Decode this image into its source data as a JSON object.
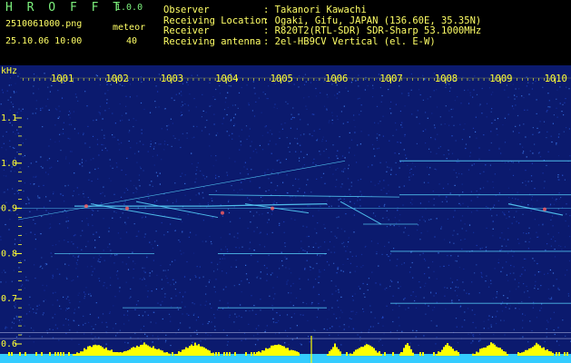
{
  "header": {
    "app_title": "H R O F F T",
    "app_version": "1.0.0",
    "file_name": "2510061000.png",
    "meteor_label": "meteor",
    "date_time": "25.10.06 10:00",
    "meteor_count": "40"
  },
  "info": [
    {
      "label": "Observer",
      "value": ": Takanori Kawachi"
    },
    {
      "label": "Receiving Location",
      "value": ": Ogaki, Gifu, JAPAN (136.60E, 35.35N)"
    },
    {
      "label": "Receiver",
      "value": ": R820T2(RTL-SDR) SDR-Sharp 53.1000MHz"
    },
    {
      "label": "Receiving antenna",
      "value": ": 2el-HB9CV Vertical (el. E-W)"
    }
  ],
  "plot": {
    "y_unit": "kHz",
    "y_ticks": [
      "1.1",
      "1.0",
      "0.9",
      "0.8",
      "0.7",
      "0.6"
    ],
    "time_ticks": [
      "1001",
      "1002",
      "1003",
      "1004",
      "1005",
      "1006",
      "1007",
      "1008",
      "1009",
      "1010"
    ],
    "colors": {
      "label_yellow": "#ffff33",
      "background": "#0b1a6e",
      "trace": "#5ad8ff",
      "bar_yellow": "#ffff00",
      "bar_cyan": "#33ccff"
    }
  }
}
